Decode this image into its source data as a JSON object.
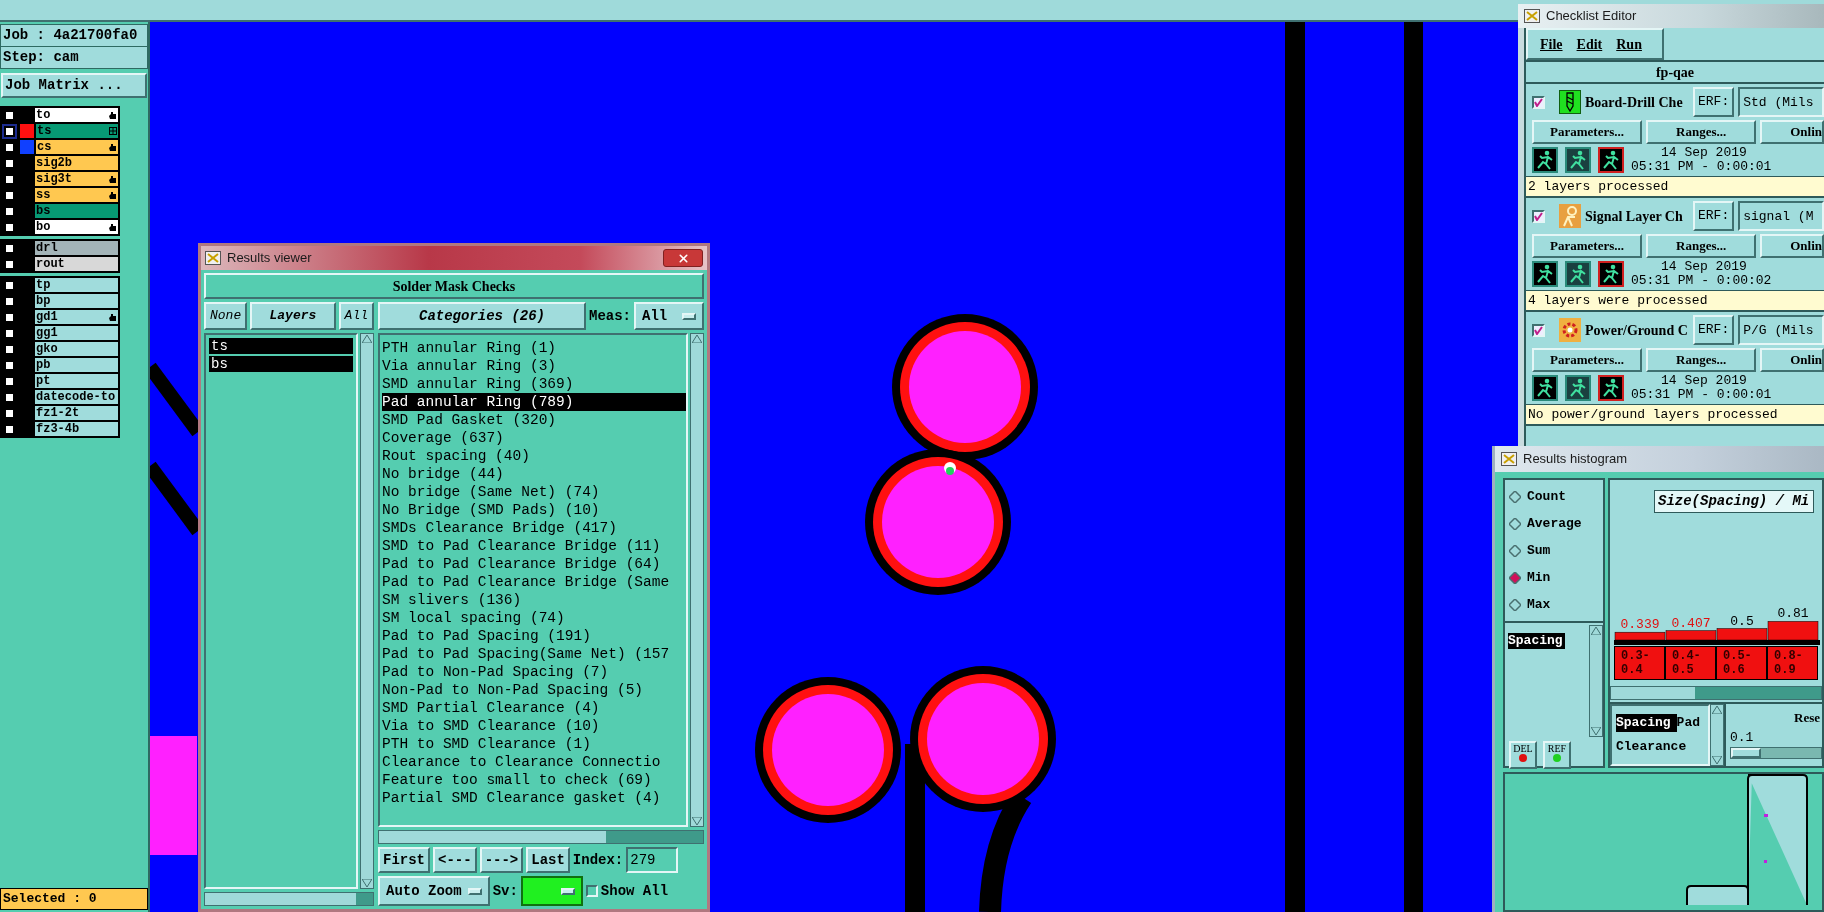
{
  "job_panel": {
    "job": "Job : 4a21700fa0",
    "step": "Step: cam",
    "matrix_button": "Job Matrix ...",
    "status": "Selected : 0"
  },
  "layer_groups": [
    {
      "layers": [
        {
          "name": "to",
          "checked": false,
          "selected": false,
          "color": "#ffffff",
          "hand_mark": true,
          "grid_mark": false
        },
        {
          "name": "ts",
          "checked": false,
          "selected": true,
          "color": "#079a74",
          "swatch": {
            "color": "#ff1010"
          },
          "hand_mark": false,
          "grid_mark": true
        },
        {
          "name": "cs",
          "checked": false,
          "selected": false,
          "color": "#ffc850",
          "swatch": {
            "color": "#1040ff"
          },
          "hand_mark": true,
          "grid_mark": false
        },
        {
          "name": "sig2b",
          "checked": false,
          "selected": false,
          "color": "#ffc850",
          "hand_mark": false,
          "grid_mark": false
        },
        {
          "name": "sig3t",
          "checked": false,
          "selected": false,
          "color": "#ffc850",
          "hand_mark": true,
          "grid_mark": false
        },
        {
          "name": "ss",
          "checked": false,
          "selected": false,
          "color": "#ffc850",
          "hand_mark": true,
          "grid_mark": false
        },
        {
          "name": "bs",
          "checked": false,
          "selected": false,
          "color": "#079a74",
          "hand_mark": false,
          "grid_mark": false
        },
        {
          "name": "bo",
          "checked": false,
          "selected": false,
          "color": "#ffffff",
          "hand_mark": true,
          "grid_mark": false
        }
      ]
    },
    {
      "layers": [
        {
          "name": "drl",
          "checked": false,
          "selected": false,
          "color": "#a3b4b8",
          "hand_mark": false,
          "grid_mark": false
        },
        {
          "name": "rout",
          "checked": false,
          "selected": false,
          "color": "#d8d8d8",
          "hand_mark": false,
          "grid_mark": false
        }
      ]
    },
    {
      "layers": [
        {
          "name": "tp",
          "checked": false,
          "selected": false,
          "color": "#a0dcdc",
          "hand_mark": false,
          "grid_mark": false
        },
        {
          "name": "bp",
          "checked": false,
          "selected": false,
          "color": "#a0dcdc",
          "hand_mark": false,
          "grid_mark": false
        },
        {
          "name": "gd1",
          "checked": false,
          "selected": false,
          "color": "#a0dcdc",
          "hand_mark": true,
          "grid_mark": false
        },
        {
          "name": "gg1",
          "checked": false,
          "selected": false,
          "color": "#a0dcdc",
          "hand_mark": false,
          "grid_mark": false
        },
        {
          "name": "gko",
          "checked": false,
          "selected": false,
          "color": "#a0dcdc",
          "hand_mark": false,
          "grid_mark": false
        },
        {
          "name": "pb",
          "checked": false,
          "selected": false,
          "color": "#a0dcdc",
          "hand_mark": false,
          "grid_mark": false
        },
        {
          "name": "pt",
          "checked": false,
          "selected": false,
          "color": "#a0dcdc",
          "hand_mark": false,
          "grid_mark": false
        },
        {
          "name": "datecode-to",
          "checked": false,
          "selected": false,
          "color": "#a0dcdc",
          "hand_mark": false,
          "grid_mark": false
        },
        {
          "name": "fz1-2t",
          "checked": false,
          "selected": false,
          "color": "#a0dcdc",
          "hand_mark": false,
          "grid_mark": false
        },
        {
          "name": "fz3-4b",
          "checked": false,
          "selected": false,
          "color": "#a0dcdc",
          "hand_mark": false,
          "grid_mark": false
        }
      ]
    }
  ],
  "results_viewer": {
    "title": "Results viewer",
    "header": "Solder Mask Checks",
    "layer_buttons": [
      "None",
      "Layers",
      "All"
    ],
    "layers": [
      {
        "text": "ts",
        "selected": true
      },
      {
        "text": "bs",
        "selected": true
      }
    ],
    "categories_button": "Categories (26)",
    "meas_label": "Meas:",
    "meas_value": "All",
    "categories": [
      {
        "text": "PTH annular Ring (1)",
        "selected": false
      },
      {
        "text": "Via annular Ring (3)",
        "selected": false
      },
      {
        "text": "SMD annular Ring (369)",
        "selected": false
      },
      {
        "text": "Pad annular Ring (789)",
        "selected": true
      },
      {
        "text": "SMD Pad Gasket (320)",
        "selected": false
      },
      {
        "text": "Coverage (637)",
        "selected": false
      },
      {
        "text": "Rout spacing (40)",
        "selected": false
      },
      {
        "text": "No bridge (44)",
        "selected": false
      },
      {
        "text": "No bridge (Same Net) (74)",
        "selected": false
      },
      {
        "text": "No Bridge (SMD Pads) (10)",
        "selected": false
      },
      {
        "text": "SMDs Clearance Bridge (417)",
        "selected": false
      },
      {
        "text": "SMD to Pad Clearance Bridge (11)",
        "selected": false
      },
      {
        "text": "Pad to Pad Clearance Bridge (64)",
        "selected": false
      },
      {
        "text": "Pad to Pad Clearance Bridge (Same",
        "selected": false
      },
      {
        "text": "SM slivers (136)",
        "selected": false
      },
      {
        "text": "SM local spacing (74)",
        "selected": false
      },
      {
        "text": "Pad to Pad Spacing (191)",
        "selected": false
      },
      {
        "text": "Pad to Pad Spacing(Same Net) (157",
        "selected": false
      },
      {
        "text": "Pad to Non-Pad Spacing (7)",
        "selected": false
      },
      {
        "text": "Non-Pad to Non-Pad Spacing (5)",
        "selected": false
      },
      {
        "text": "SMD Partial Clearance (4)",
        "selected": false
      },
      {
        "text": "Via to SMD Clearance (10)",
        "selected": false
      },
      {
        "text": "PTH to SMD Clearance (1)",
        "selected": false
      },
      {
        "text": "Clearance to Clearance Connectio",
        "selected": false
      },
      {
        "text": "Feature too small to check (69)",
        "selected": false
      },
      {
        "text": "Partial SMD Clearance gasket (4)",
        "selected": false
      }
    ],
    "nav_buttons": [
      "First",
      "<---",
      "--->",
      "Last"
    ],
    "index_label": "Index:",
    "index_value": "279",
    "zoom_mode": "Auto Zoom",
    "sv_label": "Sv:",
    "sv": {
      "color": "#20f020"
    },
    "show_all": {
      "label": "Show All",
      "checked": false
    }
  },
  "checklist_editor": {
    "title": "Checklist Editor",
    "menu": [
      "File",
      "Edit",
      "Run"
    ],
    "checklist_name": "fp-qae",
    "checks": [
      {
        "kind": "drill",
        "checked": true,
        "name": "Board-Drill Che",
        "erf_label": "ERF:",
        "erf_value": "Std (Mils",
        "buttons": [
          "Parameters...",
          "Ranges...",
          "Onlin"
        ],
        "date": "14 Sep 2019",
        "time": "05:31 PM - 0:00:01",
        "message": "2 layers processed"
      },
      {
        "kind": "signal",
        "checked": true,
        "name": "Signal Layer Ch",
        "erf_label": "ERF:",
        "erf_value": "signal (M",
        "buttons": [
          "Parameters...",
          "Ranges...",
          "Onlin"
        ],
        "date": "14 Sep 2019",
        "time": "05:31 PM - 0:00:02",
        "message": "4 layers were processed"
      },
      {
        "kind": "power",
        "checked": true,
        "name": "Power/Ground C",
        "erf_label": "ERF:",
        "erf_value": "P/G (Mils",
        "buttons": [
          "Parameters...",
          "Ranges...",
          "Onlin"
        ],
        "date": "14 Sep 2019",
        "time": "05:31 PM - 0:00:01",
        "message": "No power/ground layers processed"
      }
    ]
  },
  "results_histogram": {
    "title": "Results histogram",
    "modes": [
      {
        "label": "Count",
        "selected": false
      },
      {
        "label": "Average",
        "selected": false
      },
      {
        "label": "Sum",
        "selected": false
      },
      {
        "label": "Min",
        "selected": true
      },
      {
        "label": "Max",
        "selected": false
      }
    ],
    "metrics": [
      {
        "text": "Spacing",
        "selected": true
      }
    ],
    "buttons": [
      "DEL",
      "REF"
    ],
    "chart_title": "Size(Spacing) / Mi",
    "flagged_labels": [
      true,
      true,
      false,
      false
    ],
    "chart_data": {
      "type": "bar",
      "categories": [
        "0.3-0.4",
        "0.4-0.5",
        "0.5-0.6",
        "0.8-0.9"
      ],
      "values": [
        0.339,
        0.407,
        0.5,
        0.81
      ],
      "value_labels": [
        "0.339",
        "0.407",
        "0.5",
        "0.81"
      ]
    },
    "measures": [
      {
        "text": "Spacing",
        "selected": true
      },
      {
        "text": "Pad",
        "selected": false
      },
      {
        "text": "Clearance",
        "selected": false
      }
    ],
    "range_label": "Rese",
    "range_value": "0.1",
    "range_slider": {
      "level": 0
    }
  }
}
